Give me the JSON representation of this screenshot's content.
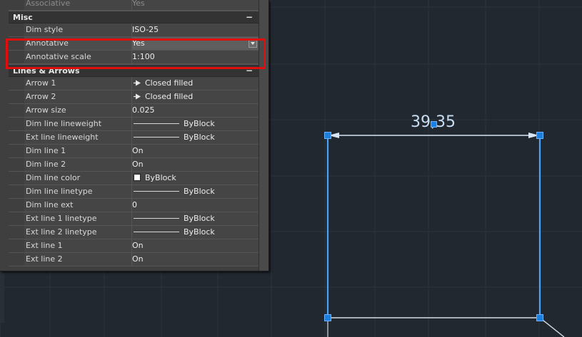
{
  "panel": {
    "top_row": {
      "label": "Associative",
      "value": "Yes"
    },
    "sections": [
      {
        "title": "Misc",
        "collapse": "−",
        "rows": [
          {
            "label": "Dim style",
            "value": "ISO-25"
          },
          {
            "label": "Annotative",
            "value": "Yes",
            "selected": true
          },
          {
            "label": "Annotative scale",
            "value": "1:100"
          }
        ]
      },
      {
        "title": "Lines & Arrows",
        "collapse": "−",
        "rows": [
          {
            "label": "Arrow 1",
            "value": "Closed filled",
            "icon": "arrow-icon"
          },
          {
            "label": "Arrow 2",
            "value": "Closed filled",
            "icon": "arrow-icon"
          },
          {
            "label": "Arrow size",
            "value": "0.025"
          },
          {
            "label": "Dim line lineweight",
            "value": "ByBlock",
            "icon": "line-sample-icon"
          },
          {
            "label": "Ext line lineweight",
            "value": "ByBlock",
            "icon": "line-sample-icon"
          },
          {
            "label": "Dim line 1",
            "value": "On"
          },
          {
            "label": "Dim line 2",
            "value": "On"
          },
          {
            "label": "Dim line color",
            "value": "ByBlock",
            "icon": "color-swatch-icon"
          },
          {
            "label": "Dim line linetype",
            "value": "ByBlock",
            "icon": "line-sample-icon"
          },
          {
            "label": "Dim line ext",
            "value": "0"
          },
          {
            "label": "Ext line 1 linetype",
            "value": "ByBlock",
            "icon": "line-sample-icon"
          },
          {
            "label": "Ext line 2 linetype",
            "value": "ByBlock",
            "icon": "line-sample-icon"
          },
          {
            "label": "Ext line 1",
            "value": "On"
          },
          {
            "label": "Ext line 2",
            "value": "On"
          }
        ]
      }
    ]
  },
  "drawing": {
    "dimension_text": "39,35",
    "background_color": "#212830",
    "grid_color": "#2c343d",
    "selection_color": "#1d7fe0",
    "highlight_color": "#e30d0d"
  }
}
